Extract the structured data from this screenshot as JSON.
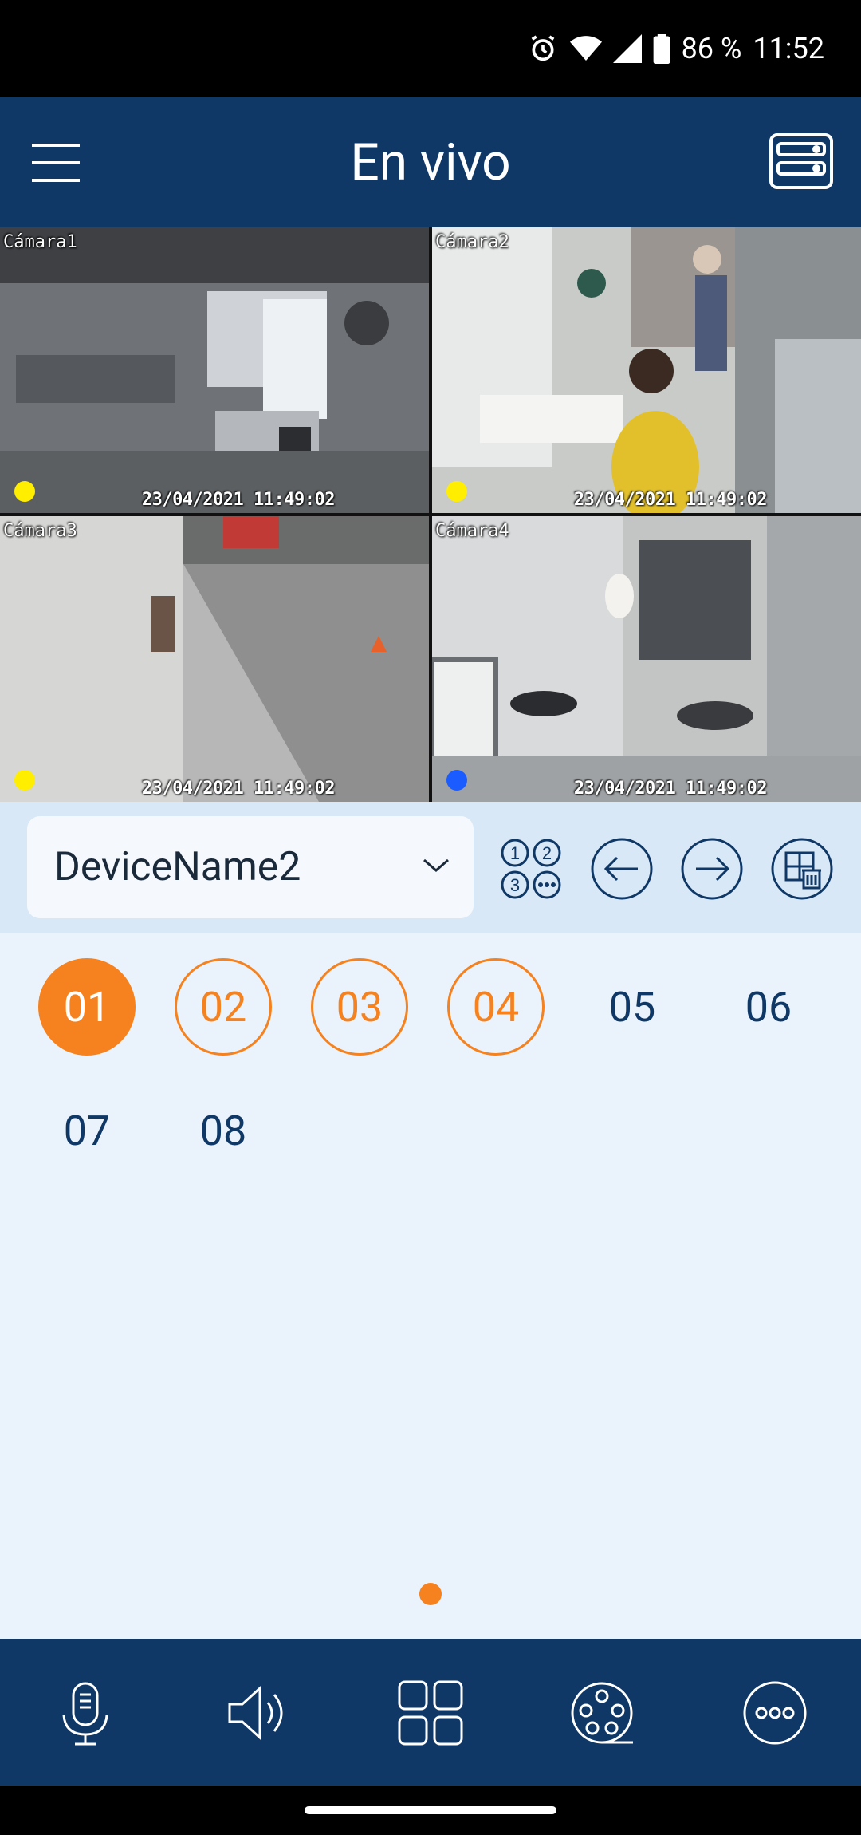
{
  "status_bar": {
    "battery": "86 %",
    "time": "11:52"
  },
  "header": {
    "title": "En vivo"
  },
  "cameras": [
    {
      "label": "Cámara1",
      "timestamp": "23/04/2021 11:49:02",
      "dot_color": "#ffee00",
      "selected": true
    },
    {
      "label": "Cámara2",
      "timestamp": "23/04/2021 11:49:02",
      "dot_color": "#ffee00",
      "selected": false
    },
    {
      "label": "Cámara3",
      "timestamp": "23/04/2021 11:49:02",
      "dot_color": "#ffee00",
      "selected": false
    },
    {
      "label": "Cámara4",
      "timestamp": "23/04/2021 11:49:02",
      "dot_color": "#1a5cff",
      "selected": false
    }
  ],
  "device_selector": {
    "value": "DeviceName2"
  },
  "channels": [
    {
      "label": "01",
      "state": "active"
    },
    {
      "label": "02",
      "state": "on"
    },
    {
      "label": "03",
      "state": "on"
    },
    {
      "label": "04",
      "state": "on"
    },
    {
      "label": "05",
      "state": "off"
    },
    {
      "label": "06",
      "state": "off"
    },
    {
      "label": "07",
      "state": "off"
    },
    {
      "label": "08",
      "state": "off"
    }
  ],
  "colors": {
    "primary": "#0f3866",
    "accent": "#f5821f",
    "panel": "#d8e8f6",
    "background": "#eaf3fb"
  },
  "icons": {
    "status": [
      "alarm-icon",
      "wifi-icon",
      "signal-icon",
      "battery-icon"
    ],
    "header": [
      "menu-icon",
      "device-list-icon"
    ],
    "controls": [
      "channel-numbers-icon",
      "previous-arrow-icon",
      "next-arrow-icon",
      "clear-layout-icon"
    ],
    "toolbar": [
      "microphone-icon",
      "speaker-icon",
      "layout-grid-icon",
      "record-film-icon",
      "more-icon"
    ]
  }
}
